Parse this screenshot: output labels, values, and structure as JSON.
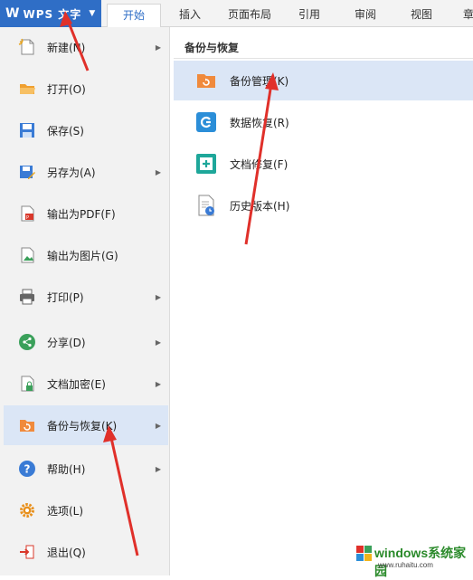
{
  "app": {
    "title": "WPS 文字"
  },
  "tabs": [
    {
      "label": "开始"
    },
    {
      "label": "插入"
    },
    {
      "label": "页面布局"
    },
    {
      "label": "引用"
    },
    {
      "label": "审阅"
    },
    {
      "label": "视图"
    },
    {
      "label": "章"
    }
  ],
  "menu": {
    "items": [
      {
        "label": "新建(N)",
        "icon": "new-document-icon"
      },
      {
        "label": "打开(O)",
        "icon": "folder-open-icon"
      },
      {
        "label": "保存(S)",
        "icon": "save-icon"
      },
      {
        "label": "另存为(A)",
        "icon": "save-as-icon"
      },
      {
        "label": "输出为PDF(F)",
        "icon": "pdf-icon"
      },
      {
        "label": "输出为图片(G)",
        "icon": "image-export-icon"
      },
      {
        "label": "打印(P)",
        "icon": "printer-icon"
      },
      {
        "label": "分享(D)",
        "icon": "share-icon"
      },
      {
        "label": "文档加密(E)",
        "icon": "lock-document-icon"
      },
      {
        "label": "备份与恢复(K)",
        "icon": "backup-restore-icon"
      },
      {
        "label": "帮助(H)",
        "icon": "help-icon"
      },
      {
        "label": "选项(L)",
        "icon": "gear-icon"
      },
      {
        "label": "退出(Q)",
        "icon": "exit-icon"
      }
    ]
  },
  "submenu": {
    "title": "备份与恢复",
    "items": [
      {
        "label": "备份管理(K)",
        "icon": "backup-folder-icon"
      },
      {
        "label": "数据恢复(R)",
        "icon": "data-recovery-icon"
      },
      {
        "label": "文档修复(F)",
        "icon": "document-repair-icon"
      },
      {
        "label": "历史版本(H)",
        "icon": "history-version-icon"
      }
    ]
  },
  "watermark": {
    "text": "windows系统家园",
    "sub": "www.ruhaitu.com"
  },
  "colors": {
    "accent": "#2f6ec6",
    "selected": "#dbe6f6",
    "arrow": "#e0302a"
  }
}
